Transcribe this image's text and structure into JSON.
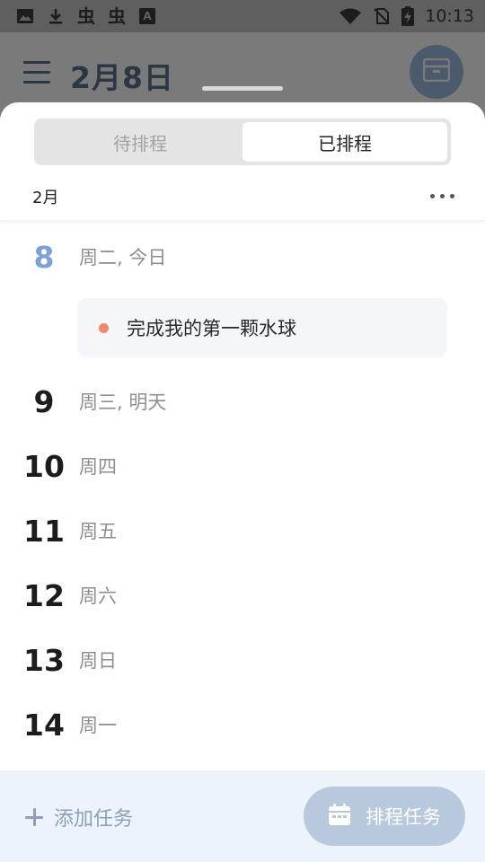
{
  "status_bar": {
    "left_icons": [
      "image-icon",
      "download-icon",
      "app-icon",
      "app-icon",
      "a-box-icon"
    ],
    "app_glyph": "虫",
    "a_glyph": "A",
    "right_icons": [
      "wifi-icon",
      "no-sim-icon",
      "battery-charging-icon"
    ],
    "time": "10:13"
  },
  "header": {
    "menu_icon": "menu-icon",
    "title": "2月8日",
    "action_icon": "inbox-icon"
  },
  "sheet": {
    "segments": [
      {
        "label": "待排程",
        "active": false
      },
      {
        "label": "已排程",
        "active": true
      }
    ],
    "month": "2月",
    "more_icon": "more-horizontal-icon",
    "days": [
      {
        "num": "8",
        "label": "周二, 今日",
        "today": true
      },
      {
        "num": "9",
        "label": "周三, 明天",
        "today": false
      },
      {
        "num": "10",
        "label": "周四",
        "today": false
      },
      {
        "num": "11",
        "label": "周五",
        "today": false
      },
      {
        "num": "12",
        "label": "周六",
        "today": false
      },
      {
        "num": "13",
        "label": "周日",
        "today": false
      },
      {
        "num": "14",
        "label": "周一",
        "today": false
      }
    ],
    "task": {
      "text": "完成我的第一颗水球",
      "dot_color": "#f0896a"
    }
  },
  "bottom_bar": {
    "add_label": "添加任务",
    "schedule_label": "排程任务",
    "schedule_icon": "calendar-icon"
  },
  "colors": {
    "today_accent": "#7c9fd8",
    "button_bg": "#b9c9dd",
    "bottom_bar_bg": "#edf3fb"
  }
}
